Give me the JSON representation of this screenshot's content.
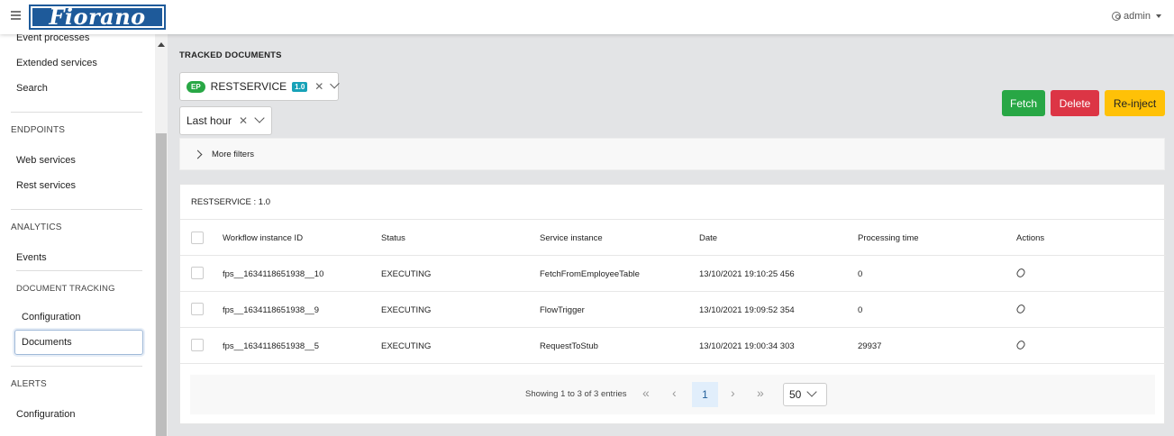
{
  "header": {
    "brand": "Fiorano",
    "user": "admin"
  },
  "sidebar": {
    "top_items": [
      "Event processes",
      "Extended services",
      "Search"
    ],
    "sections": [
      {
        "title": "ENDPOINTS",
        "items": [
          "Web services",
          "Rest services"
        ]
      },
      {
        "title": "ANALYTICS",
        "items": [
          "Events"
        ]
      },
      {
        "title": "DOCUMENT TRACKING",
        "items": [
          "Configuration",
          "Documents"
        ]
      },
      {
        "title": "ALERTS",
        "items": [
          "Configuration"
        ]
      }
    ],
    "active_item": "Documents"
  },
  "page": {
    "title": "TRACKED DOCUMENTS",
    "service_filter": {
      "badge": "EP",
      "name": "RESTSERVICE",
      "version": "1.0"
    },
    "time_filter": "Last hour",
    "buttons": {
      "fetch": "Fetch",
      "delete": "Delete",
      "reinject": "Re-inject"
    },
    "more_filters": "More filters"
  },
  "table": {
    "title": "RESTSERVICE : 1.0",
    "columns": [
      "Workflow instance ID",
      "Status",
      "Service instance",
      "Date",
      "Processing time",
      "Actions"
    ],
    "rows": [
      {
        "id": "fps__1634118651938__10",
        "status": "EXECUTING",
        "service": "FetchFromEmployeeTable",
        "date": "13/10/2021 19:10:25 456",
        "time": "0"
      },
      {
        "id": "fps__1634118651938__9",
        "status": "EXECUTING",
        "service": "FlowTrigger",
        "date": "13/10/2021 19:09:52 354",
        "time": "0"
      },
      {
        "id": "fps__1634118651938__5",
        "status": "EXECUTING",
        "service": "RequestToStub",
        "date": "13/10/2021 19:00:34 303",
        "time": "29937"
      }
    ]
  },
  "pagination": {
    "summary": "Showing 1 to 3 of 3 entries",
    "current_page": "1",
    "page_size": "50"
  },
  "colors": {
    "fetch": "#28a745",
    "delete": "#dc3545",
    "reinject": "#ffc107",
    "version_badge": "#17a2b8",
    "brand": "#1e5a9a"
  }
}
